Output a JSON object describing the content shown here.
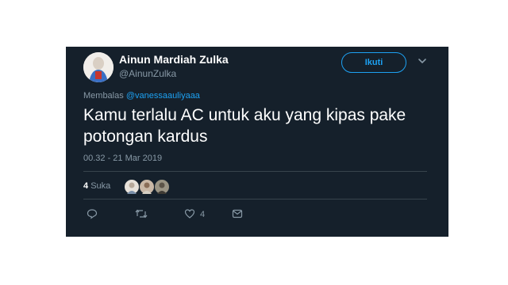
{
  "user": {
    "display_name": "Ainun Mardiah Zulka",
    "handle": "@AinunZulka"
  },
  "follow_button_label": "Ikuti",
  "reply": {
    "prefix": "Membalas",
    "mention": "@vanessaauliyaaa"
  },
  "tweet_text_line1": "Kamu terlalu AC untuk aku yang kipas pake",
  "tweet_text_line2": "potongan kardus",
  "timestamp": "00.32 - 21 Mar 2019",
  "likes": {
    "count": "4",
    "label": "Suka"
  },
  "actions": {
    "like_count": "4",
    "icons": [
      "reply-icon",
      "retweet-icon",
      "like-icon",
      "dm-icon"
    ]
  },
  "colors": {
    "background": "#15202b",
    "accent": "#1da1f2",
    "secondary_text": "#8899a6"
  }
}
